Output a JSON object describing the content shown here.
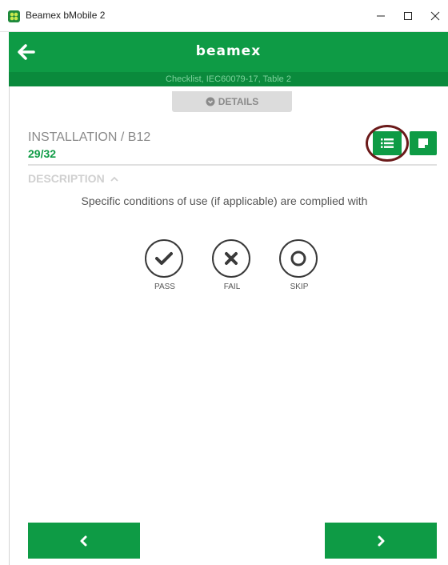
{
  "window": {
    "title": "Beamex bMobile 2"
  },
  "header": {
    "brand": "beamex",
    "subtitle": "Checklist, IEC60079-17, Table 2"
  },
  "details_tab": {
    "label": "DETAILS"
  },
  "item": {
    "title": "INSTALLATION / B12",
    "progress": "29/32"
  },
  "description": {
    "label": "DESCRIPTION",
    "text": "Specific conditions of use (if applicable) are complied with"
  },
  "choices": {
    "pass": "PASS",
    "fail": "FAIL",
    "skip": "SKIP"
  },
  "colors": {
    "accent": "#0e9b45",
    "accent_dark": "#0a8a3c",
    "highlight": "#6b1a1a"
  },
  "icons": [
    "app-icon",
    "back-arrow-icon",
    "info-circle-icon",
    "list-icon",
    "note-icon",
    "chevron-up-icon",
    "check-icon",
    "x-icon",
    "circle-icon",
    "chevron-left-icon",
    "chevron-right-icon"
  ]
}
